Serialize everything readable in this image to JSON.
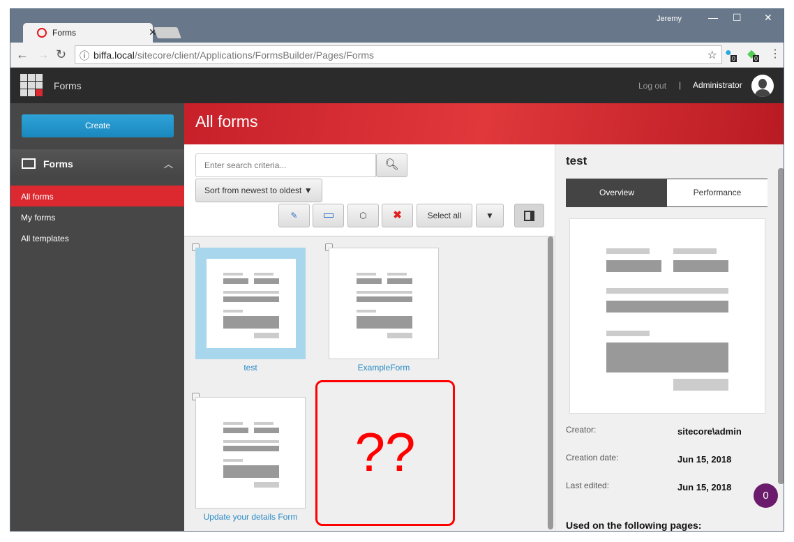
{
  "browser": {
    "tab_title": "Forms",
    "user": "Jeremy",
    "url_host": "biffa.local",
    "url_path": "/sitecore/client/Applications/FormsBuilder/Pages/Forms",
    "ext_badges": [
      "0",
      "0"
    ]
  },
  "app": {
    "title": "Forms",
    "logout": "Log out",
    "separator": "|",
    "user": "Administrator"
  },
  "sidebar": {
    "create_label": "Create",
    "section": "Forms",
    "items": [
      {
        "label": "All forms",
        "active": true
      },
      {
        "label": "My forms"
      },
      {
        "label": "All templates"
      }
    ]
  },
  "main": {
    "title": "All forms",
    "search_placeholder": "Enter search criteria...",
    "sort_label": "Sort from newest to oldest",
    "select_all": "Select all",
    "forms": [
      {
        "name": "test",
        "selected": true
      },
      {
        "name": "ExampleForm"
      },
      {
        "name": "Update your details Form"
      }
    ],
    "placeholder_text": "??"
  },
  "details": {
    "title": "test",
    "tabs": [
      "Overview",
      "Performance"
    ],
    "active_tab": "Overview",
    "fields": [
      {
        "label": "Creator:",
        "value": "sitecore\\admin"
      },
      {
        "label": "Creation date:",
        "value": "Jun 15, 2018"
      },
      {
        "label": "Last edited:",
        "value": "Jun 15, 2018"
      }
    ],
    "used_on": "Used on the following pages:",
    "badge": "0"
  },
  "colors": {
    "accent": "#dc292f",
    "create": "#1f8fc6",
    "badge": "#6b1b6b"
  }
}
